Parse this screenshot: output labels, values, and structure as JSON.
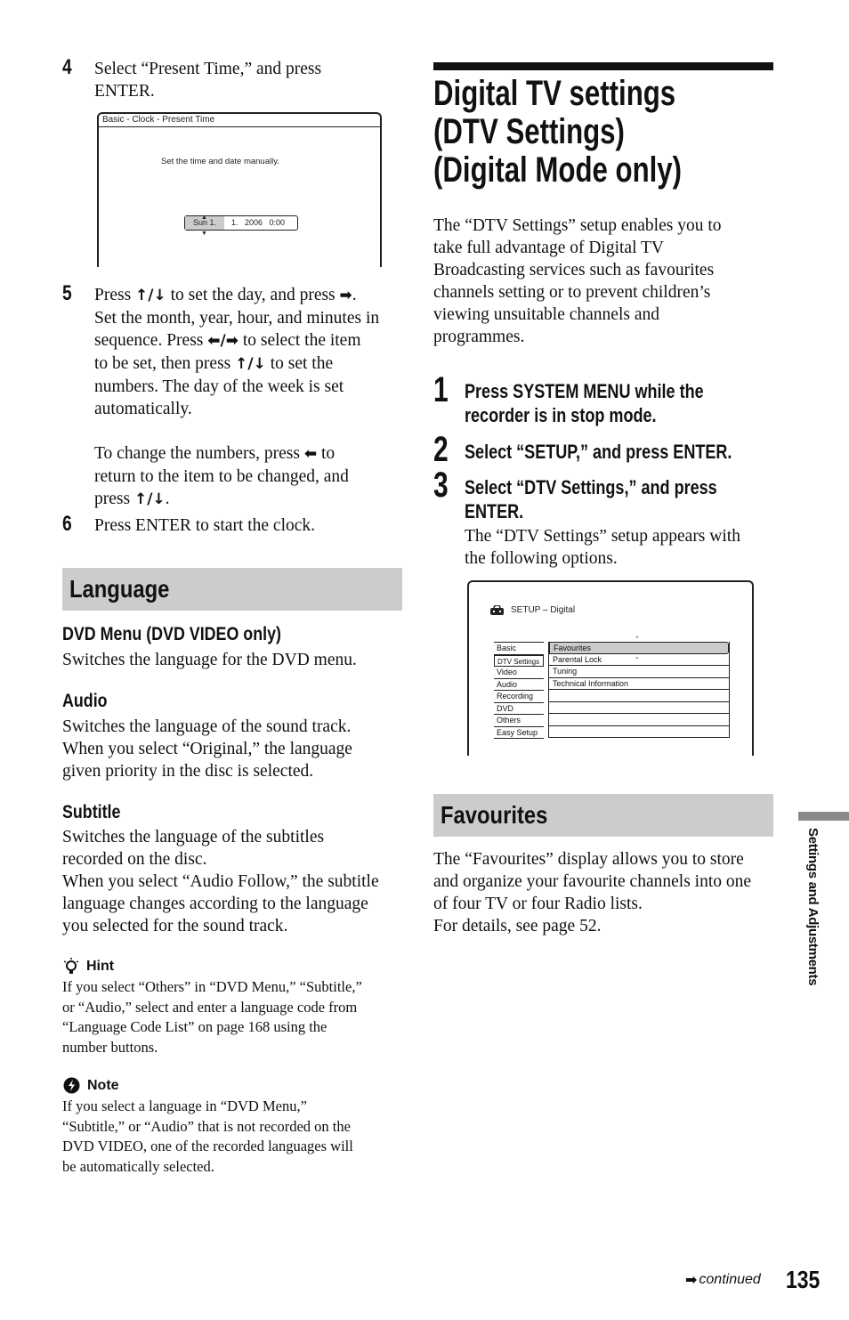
{
  "left": {
    "step4": {
      "num": "4",
      "text_a": "Select “Present Time,” and press",
      "text_b": "ENTER."
    },
    "clock_screen": {
      "title": "Basic - Clock - Present Time",
      "message": "Set the time and date manually.",
      "field_day": "Sun  1.",
      "field_rest": "1.   2006   0:00"
    },
    "step5": {
      "num": "5",
      "l1a": "Press ",
      "l1b": " to set the day, and press ",
      "l1c": ".",
      "l2": "Set the month, year, hour, and minutes in",
      "l3a": "sequence. Press ",
      "l3b": " to select the item",
      "l4a": "to be set, then press ",
      "l4b": " to set the",
      "l5": "numbers. The day of the week is set",
      "l6": "automatically.",
      "p2l1a": "To change the numbers, press ",
      "p2l1b": " to",
      "p2l2": "return to the item to be changed, and",
      "p2l3a": "press ",
      "p2l3b": "."
    },
    "step6": {
      "num": "6",
      "text": "Press ENTER to start the clock."
    },
    "language": {
      "heading": "Language",
      "items": [
        {
          "title": "DVD Menu (DVD VIDEO only)",
          "lines": [
            "Switches the language for the DVD menu."
          ]
        },
        {
          "title": "Audio",
          "lines": [
            "Switches the language of the sound track.",
            "When you select “Original,” the language",
            "given priority in the disc is selected."
          ]
        },
        {
          "title": "Subtitle",
          "lines": [
            "Switches the language of the subtitles",
            "recorded on the disc.",
            "When you select “Audio Follow,” the subtitle",
            "language changes according to the language",
            "you selected for the sound track."
          ]
        }
      ]
    },
    "hint": {
      "label": "Hint",
      "lines": [
        "If you select “Others” in “DVD Menu,” “Subtitle,”",
        "or “Audio,” select and enter a language code from",
        "“Language Code List” on page 168 using the",
        "number buttons."
      ]
    },
    "note": {
      "label": "Note",
      "lines": [
        "If you select a language in “DVD Menu,”",
        "“Subtitle,” or “Audio” that is not recorded on the",
        "DVD VIDEO, one of the recorded languages will",
        "be automatically selected."
      ]
    }
  },
  "right": {
    "title_lines": [
      "Digital TV settings",
      "(DTV Settings)",
      "(Digital Mode only)"
    ],
    "intro_lines": [
      "The “DTV Settings” setup enables you to",
      "take full advantage of Digital TV",
      "Broadcasting services such as favourites",
      "channels setting or to prevent children’s",
      "viewing unsuitable channels and",
      "programmes."
    ],
    "steps": [
      {
        "num": "1",
        "lines": [
          "Press SYSTEM MENU while the",
          "recorder is in stop mode."
        ]
      },
      {
        "num": "2",
        "lines": [
          "Select “SETUP,” and press ENTER."
        ]
      },
      {
        "num": "3",
        "lines": [
          "Select “DTV Settings,” and press",
          "ENTER."
        ],
        "desc": [
          "The “DTV Settings” setup appears with",
          "the following options."
        ]
      }
    ],
    "setup_screen": {
      "title": "SETUP – Digital",
      "left_menu": [
        "Basic",
        "DTV Settings",
        "Video",
        "Audio",
        "Recording",
        "DVD",
        "Others",
        "Easy Setup"
      ],
      "selected_left": "DTV Settings",
      "right_menu": [
        "Favourites",
        "Parental Lock",
        "Tuning",
        "Technical Information",
        "",
        "",
        "",
        ""
      ],
      "highlighted_right": "Favourites"
    },
    "favourites": {
      "heading": "Favourites",
      "lines": [
        "The “Favourites” display allows you to store",
        "and organize your favourite channels into one",
        "of four TV or four Radio lists.",
        "For details, see page 52."
      ]
    }
  },
  "side_tab": {
    "label": "Settings and Adjustments",
    "color": "#8a8a8a"
  },
  "footer": {
    "continued": "continued",
    "page": "135"
  },
  "icons": {
    "up_down": "↑/↓",
    "right": "➡",
    "left_right": "⬅/➡",
    "left": "⬅"
  }
}
